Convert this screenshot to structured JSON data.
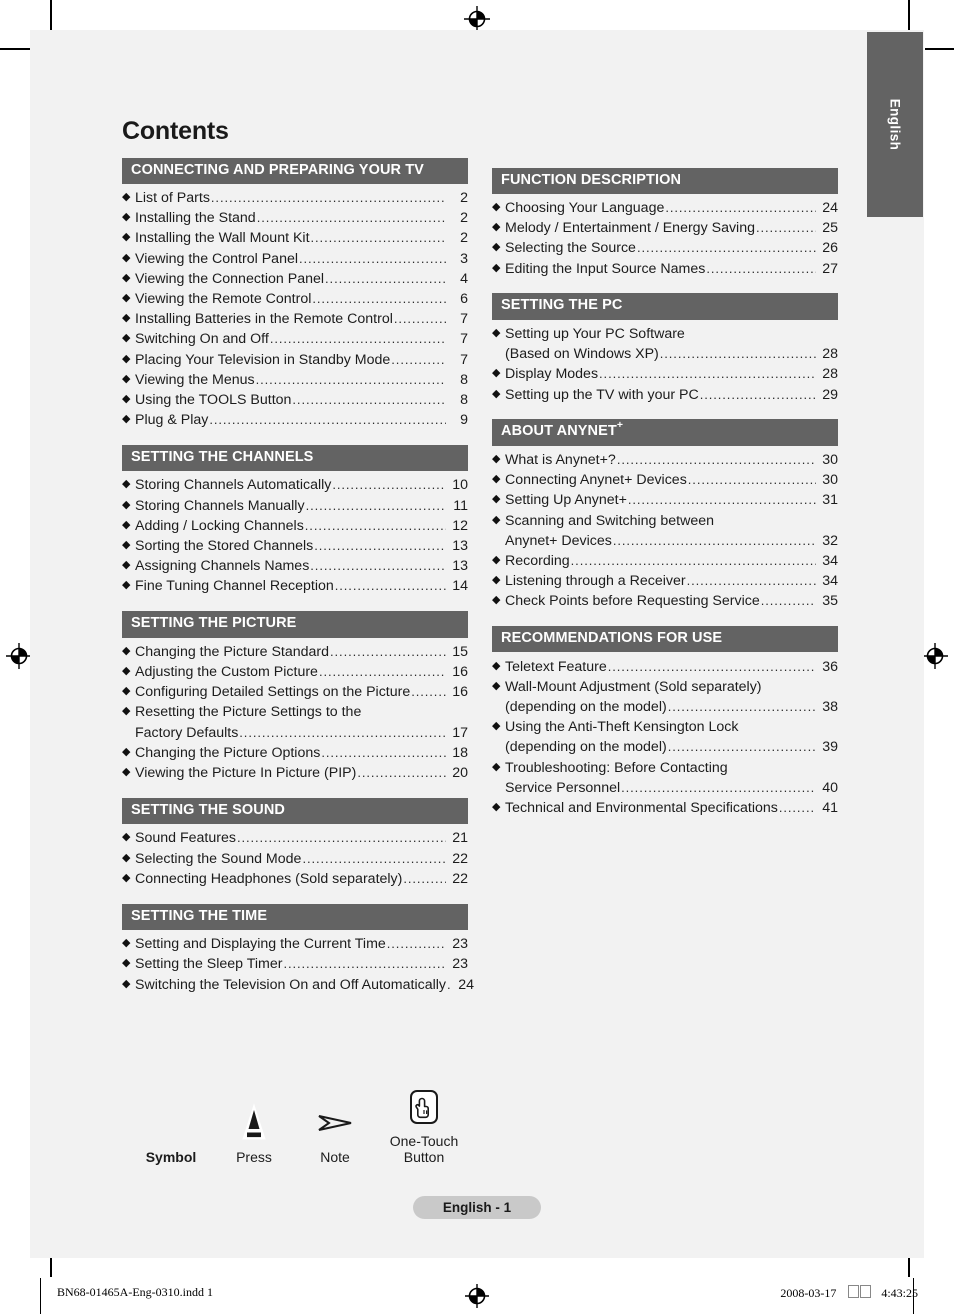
{
  "language_tab": {
    "label": "English"
  },
  "page_title": "Contents",
  "left_column": [
    {
      "header": "CONNECTING AND PREPARING YOUR TV",
      "items": [
        {
          "text": "List of Parts",
          "page": "2"
        },
        {
          "text": "Installing the Stand",
          "page": "2"
        },
        {
          "text": "Installing the Wall Mount Kit",
          "page": "2"
        },
        {
          "text": "Viewing the Control Panel",
          "page": "3"
        },
        {
          "text": "Viewing the Connection Panel",
          "page": "4"
        },
        {
          "text": "Viewing the Remote Control",
          "page": "6"
        },
        {
          "text": "Installing Batteries in the Remote Control",
          "page": "7"
        },
        {
          "text": "Switching On and Off",
          "page": "7"
        },
        {
          "text": "Placing Your Television in Standby Mode",
          "page": "7"
        },
        {
          "text": "Viewing the Menus",
          "page": "8"
        },
        {
          "text": "Using the TOOLS Button",
          "page": "8"
        },
        {
          "text": "Plug & Play",
          "page": "9"
        }
      ]
    },
    {
      "header": "SETTING THE CHANNELS",
      "items": [
        {
          "text": "Storing Channels Automatically",
          "page": "10"
        },
        {
          "text": "Storing Channels Manually",
          "page": "11"
        },
        {
          "text": "Adding / Locking Channels",
          "page": "12"
        },
        {
          "text": "Sorting the Stored Channels",
          "page": "13"
        },
        {
          "text": "Assigning Channels Names",
          "page": "13"
        },
        {
          "text": "Fine Tuning Channel Reception",
          "page": "14"
        }
      ]
    },
    {
      "header": "SETTING THE PICTURE",
      "items": [
        {
          "text": "Changing the Picture Standard",
          "page": "15"
        },
        {
          "text": "Adjusting the Custom Picture",
          "page": "16"
        },
        {
          "text": "Configuring Detailed Settings on the Picture",
          "page": "16"
        },
        {
          "text": "Resetting the Picture Settings to the",
          "page": "",
          "wrap": "start"
        },
        {
          "text": "Factory Defaults",
          "page": "17",
          "wrap": "end"
        },
        {
          "text": "Changing the Picture Options",
          "page": "18"
        },
        {
          "text": "Viewing the Picture In Picture (PIP)",
          "page": "20"
        }
      ]
    },
    {
      "header": "SETTING THE SOUND",
      "items": [
        {
          "text": "Sound Features",
          "page": "21"
        },
        {
          "text": "Selecting the Sound Mode",
          "page": "22"
        },
        {
          "text": "Connecting Headphones (Sold separately)",
          "page": "22"
        }
      ]
    },
    {
      "header": "SETTING THE TIME",
      "items": [
        {
          "text": "Setting and Displaying the Current Time",
          "page": "23"
        },
        {
          "text": "Setting the Sleep Timer",
          "page": "23"
        },
        {
          "text": "Switching the Television On and Off Automatically",
          "page": "24"
        }
      ]
    }
  ],
  "right_column": [
    {
      "header": "FUNCTION DESCRIPTION",
      "items": [
        {
          "text": "Choosing Your Language",
          "page": "24"
        },
        {
          "text": "Melody / Entertainment / Energy Saving",
          "page": "25"
        },
        {
          "text": "Selecting the Source",
          "page": "26"
        },
        {
          "text": "Editing the Input Source Names",
          "page": "27"
        }
      ]
    },
    {
      "header": "SETTING THE PC",
      "items": [
        {
          "text": "Setting up Your PC Software",
          "page": "",
          "wrap": "start"
        },
        {
          "text": "(Based on Windows XP)",
          "page": "28",
          "wrap": "end"
        },
        {
          "text": "Display Modes",
          "page": "28"
        },
        {
          "text": "Setting up the TV with your PC",
          "page": "29"
        }
      ]
    },
    {
      "header": "ABOUT ANYNET",
      "header_sup": "+",
      "items": [
        {
          "text": "What is Anynet+?",
          "page": "30"
        },
        {
          "text": "Connecting Anynet+ Devices",
          "page": "30"
        },
        {
          "text": "Setting Up Anynet+",
          "page": "31"
        },
        {
          "text": "Scanning and Switching between",
          "page": "",
          "wrap": "start"
        },
        {
          "text": "Anynet+ Devices",
          "page": "32",
          "wrap": "end"
        },
        {
          "text": "Recording",
          "page": "34"
        },
        {
          "text": "Listening through a Receiver",
          "page": "34"
        },
        {
          "text": "Check Points before Requesting Service",
          "page": "35"
        }
      ]
    },
    {
      "header": "RECOMMENDATIONS FOR USE",
      "items": [
        {
          "text": "Teletext Feature",
          "page": "36"
        },
        {
          "text": "Wall-Mount Adjustment (Sold separately)",
          "page": "",
          "wrap": "start"
        },
        {
          "text": "(depending on the model)",
          "page": "38",
          "wrap": "end"
        },
        {
          "text": "Using the Anti-Theft Kensington Lock",
          "page": "",
          "wrap": "start"
        },
        {
          "text": "(depending on the model)",
          "page": "39",
          "wrap": "end"
        },
        {
          "text": "Troubleshooting: Before Contacting",
          "page": "",
          "wrap": "start"
        },
        {
          "text": "Service Personnel",
          "page": "40",
          "wrap": "end"
        },
        {
          "text": "Technical and Environmental Specifications",
          "page": "41"
        }
      ]
    }
  ],
  "legend": {
    "title": "Symbol",
    "entries": [
      {
        "icon": "press-triangle-icon",
        "label": "Press"
      },
      {
        "icon": "note-arrow-icon",
        "label": "Note"
      },
      {
        "icon": "one-touch-button-icon",
        "label": "One-Touch\nButton"
      }
    ]
  },
  "page_badge": "English - 1",
  "print_footer": {
    "file": "BN68-01465A-Eng-0310.indd   1",
    "date": "2008-03-17",
    "time": "4:43:25"
  },
  "colors": {
    "header_bar": "#636363",
    "page_background": "#f2f2f2",
    "badge": "#c9c9c9",
    "text": "#1c1c1c"
  }
}
